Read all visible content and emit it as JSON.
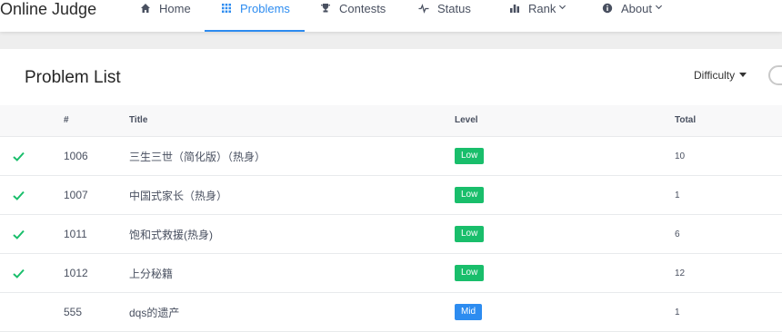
{
  "app": {
    "title": "Online Judge"
  },
  "nav": {
    "items": [
      {
        "label": "Home",
        "icon": "home-icon"
      },
      {
        "label": "Problems",
        "icon": "grid-icon",
        "active": true
      },
      {
        "label": "Contests",
        "icon": "trophy-icon"
      },
      {
        "label": "Status",
        "icon": "pulse-icon"
      },
      {
        "label": "Rank",
        "icon": "bar-chart-icon",
        "dropdown": true
      },
      {
        "label": "About",
        "icon": "info-icon",
        "dropdown": true
      }
    ]
  },
  "colors": {
    "accent": "#2d8cf0",
    "low": "#19be6b",
    "mid": "#2d8cf0",
    "accepted": "#19be6b"
  },
  "problem_list": {
    "title": "Problem List",
    "filter_label": "Difficulty",
    "columns": [
      "#",
      "Title",
      "Level",
      "Total"
    ],
    "rows": [
      {
        "solved": true,
        "id": "1006",
        "title": "三生三世（简化版）（热身）",
        "level": "Low",
        "total": "10"
      },
      {
        "solved": true,
        "id": "1007",
        "title": "中国式家长（热身）",
        "level": "Low",
        "total": "1"
      },
      {
        "solved": true,
        "id": "1011",
        "title": "饱和式救援(热身)",
        "level": "Low",
        "total": "6"
      },
      {
        "solved": true,
        "id": "1012",
        "title": "上分秘籍",
        "level": "Low",
        "total": "12"
      },
      {
        "solved": false,
        "id": "555",
        "title": "dqs的遗产",
        "level": "Mid",
        "total": "1"
      }
    ]
  }
}
